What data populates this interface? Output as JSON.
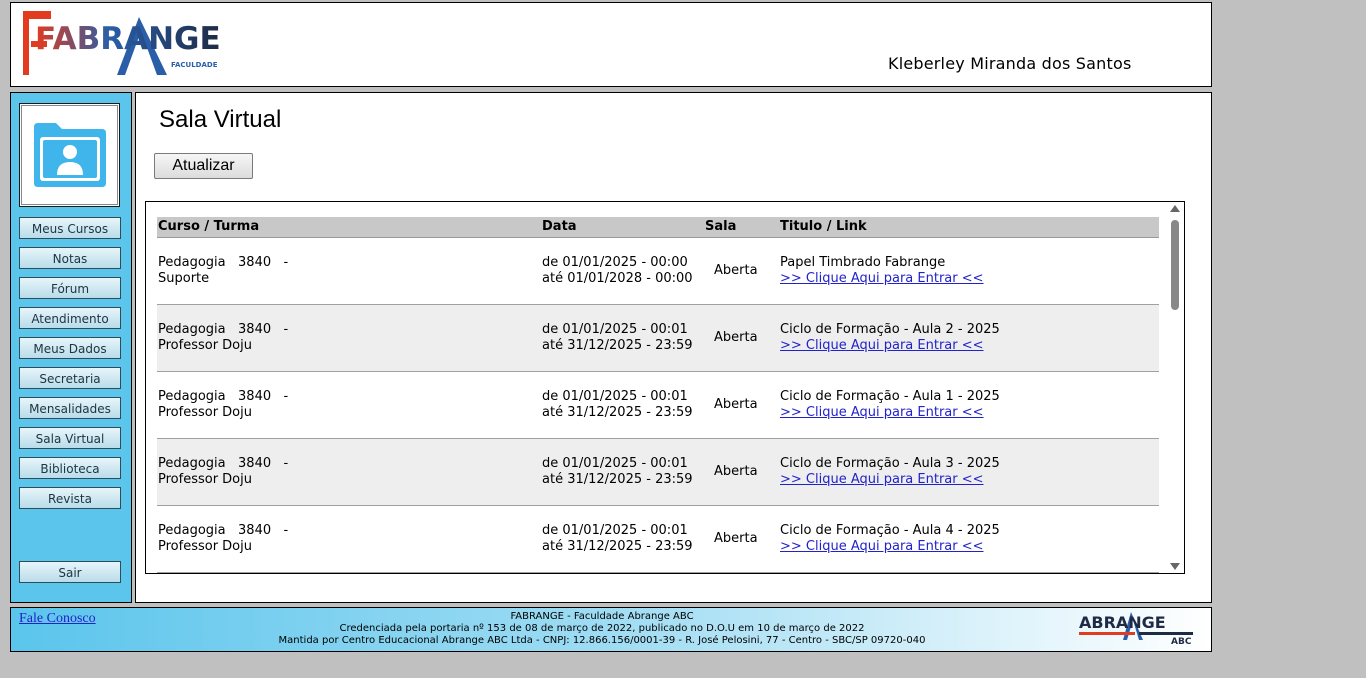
{
  "header": {
    "logo_text": "FABRANGE",
    "logo_subtext": "FACULDADE",
    "user_name": "Kleberley Miranda dos Santos"
  },
  "sidebar": {
    "items": [
      {
        "label": "Meus Cursos"
      },
      {
        "label": "Notas"
      },
      {
        "label": "Fórum"
      },
      {
        "label": "Atendimento"
      },
      {
        "label": "Meus Dados"
      },
      {
        "label": "Secretaria"
      },
      {
        "label": "Mensalidades"
      },
      {
        "label": "Sala Virtual"
      },
      {
        "label": "Biblioteca"
      },
      {
        "label": "Revista"
      }
    ],
    "logout_label": "Sair"
  },
  "main": {
    "title": "Sala Virtual",
    "refresh_label": "Atualizar",
    "table": {
      "headers": [
        "Curso / Turma",
        "Data",
        "Sala",
        "Titulo / Link"
      ],
      "rows": [
        {
          "course": "Pedagogia   3840   -",
          "group": "Suporte",
          "date_from": "de 01/01/2025 - 00:00",
          "date_to": "até 01/01/2028 - 00:00",
          "room": "Aberta",
          "title": "Papel Timbrado Fabrange",
          "link": ">> Clique Aqui para Entrar <<"
        },
        {
          "course": "Pedagogia   3840   -",
          "group": "Professor Doju",
          "date_from": "de 01/01/2025 - 00:01",
          "date_to": "até 31/12/2025 - 23:59",
          "room": "Aberta",
          "title": "Ciclo de Formação - Aula 2 - 2025",
          "link": ">> Clique Aqui para Entrar <<"
        },
        {
          "course": "Pedagogia   3840   -",
          "group": "Professor Doju",
          "date_from": "de 01/01/2025 - 00:01",
          "date_to": "até 31/12/2025 - 23:59",
          "room": "Aberta",
          "title": "Ciclo de Formação - Aula 1 - 2025",
          "link": ">> Clique Aqui para Entrar <<"
        },
        {
          "course": "Pedagogia   3840   -",
          "group": "Professor Doju",
          "date_from": "de 01/01/2025 - 00:01",
          "date_to": "até 31/12/2025 - 23:59",
          "room": "Aberta",
          "title": "Ciclo de Formação - Aula 3 - 2025",
          "link": ">> Clique Aqui para Entrar <<"
        },
        {
          "course": "Pedagogia   3840   -",
          "group": "Professor Doju",
          "date_from": "de 01/01/2025 - 00:01",
          "date_to": "até 31/12/2025 - 23:59",
          "room": "Aberta",
          "title": "Ciclo de Formação - Aula 4 - 2025",
          "link": ">> Clique Aqui para Entrar <<"
        }
      ]
    }
  },
  "footer": {
    "contact_link": "Fale Conosco",
    "line1": "FABRANGE - Faculdade Abrange ABC",
    "line2": "Credenciada pela portaria nº 153 de 08 de março de 2022, publicado no D.O.U em 10 de março de 2022",
    "line3": "Mantida por Centro Educacional Abrange ABC Ltda - CNPJ: 12.866.156/0001-39 - R. José Pelosini, 77 - Centro - SBC/SP 09720-040",
    "abc_logo_text": "ABRANGE",
    "abc_logo_subtext": "ABC"
  },
  "colors": {
    "sidebar_bg": "#5bc5ec",
    "link": "#2222cc",
    "logo_blue": "#2a5ea8",
    "logo_red": "#e23b1f",
    "logo_dark": "#1f2a44"
  }
}
